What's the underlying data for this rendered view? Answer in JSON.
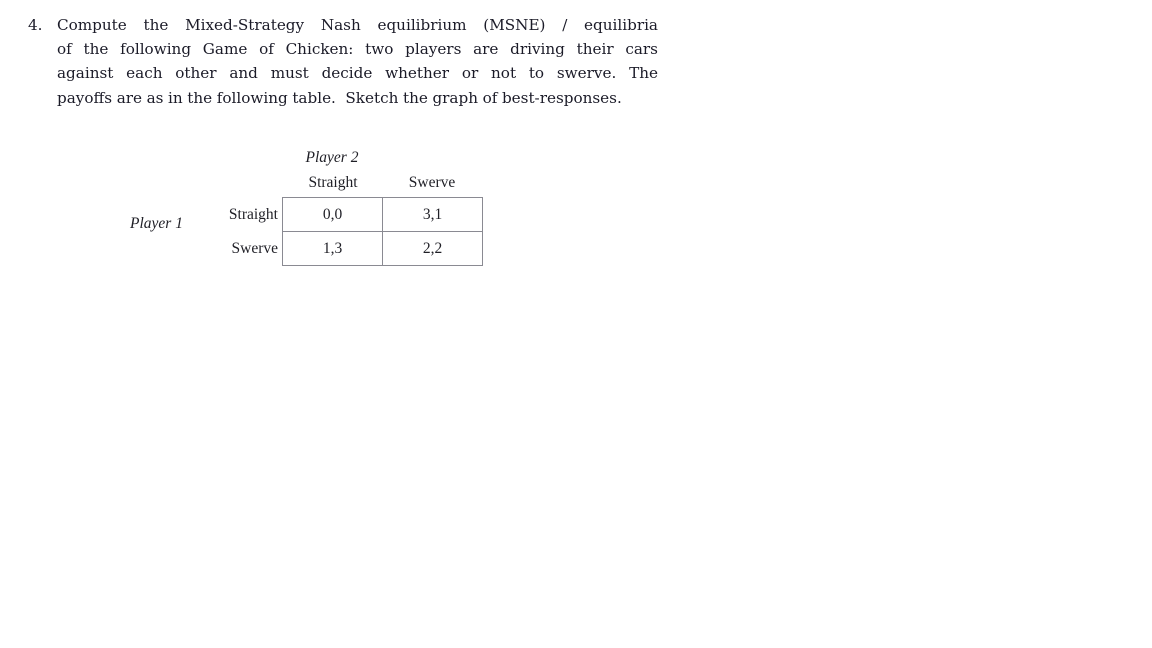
{
  "document": {
    "question": {
      "number": "4.",
      "lines": [
        {
          "words": [
            "Compute",
            "the",
            "Mixed-Strategy",
            "Nash",
            "equilibrium",
            "(MSNE)",
            "/",
            "equilibria"
          ],
          "justify": true
        },
        {
          "words": [
            "of",
            "the",
            "following",
            "Game",
            "of",
            "Chicken:",
            "two",
            "players",
            "are",
            "driving",
            "their",
            "cars"
          ],
          "justify": true
        },
        {
          "words": [
            "against",
            "each",
            "other",
            "and",
            "must",
            "decide",
            "whether",
            "or",
            "not",
            "to",
            "swerve.",
            "The"
          ],
          "justify": true
        },
        {
          "words": [
            "payoffs",
            "are",
            "as",
            "in",
            "the",
            "following",
            "table.",
            "Sketch",
            "the",
            "graph",
            "of",
            "best-responses."
          ],
          "justify": false
        }
      ],
      "full_text": "4. Compute the Mixed-Strategy Nash equilibrium (MSNE) / equilibria of the following Game of Chicken: two players are driving their cars against each other and must decide whether or not to swerve. The payoffs are as in the following table. Sketch the graph of best-responses."
    },
    "payoff_matrix": {
      "column_player_label": "Player 2",
      "row_player_label": "Player 1",
      "column_headers": [
        "Straight",
        "Swerve"
      ],
      "row_headers": [
        "Straight",
        "Swerve"
      ],
      "cells": [
        [
          "0,0",
          "3,1"
        ],
        [
          "1,3",
          "2,2"
        ]
      ],
      "border_color": "#8a8a92",
      "text_color": "#1f1f26"
    }
  },
  "page": {
    "background_color": "#ffffff",
    "text_color": "#1b1b28"
  }
}
